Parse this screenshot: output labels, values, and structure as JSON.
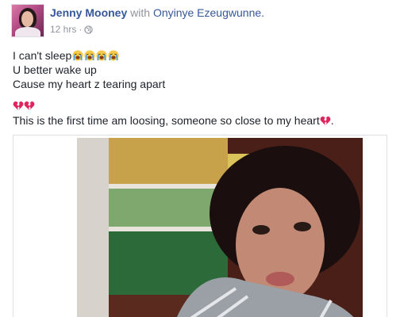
{
  "post": {
    "author": "Jenny Mooney",
    "with_word": "with",
    "tagged": "Onyinye Ezeugwunne.",
    "timestamp": "12 hrs",
    "separator": "·",
    "privacy_icon": "globe-icon",
    "lines": [
      "I can't sleep",
      "U better wake up",
      "Cause my heart z tearing apart",
      "This is the first time am loosing, someone so close to my heart",
      "."
    ],
    "emojis": {
      "crying": "loudly-crying-face-icon",
      "broken_heart": "broken-heart-icon"
    },
    "colors": {
      "link": "#365899",
      "meta": "#90949c",
      "text": "#1d2129",
      "heart": "#e0245e"
    }
  }
}
